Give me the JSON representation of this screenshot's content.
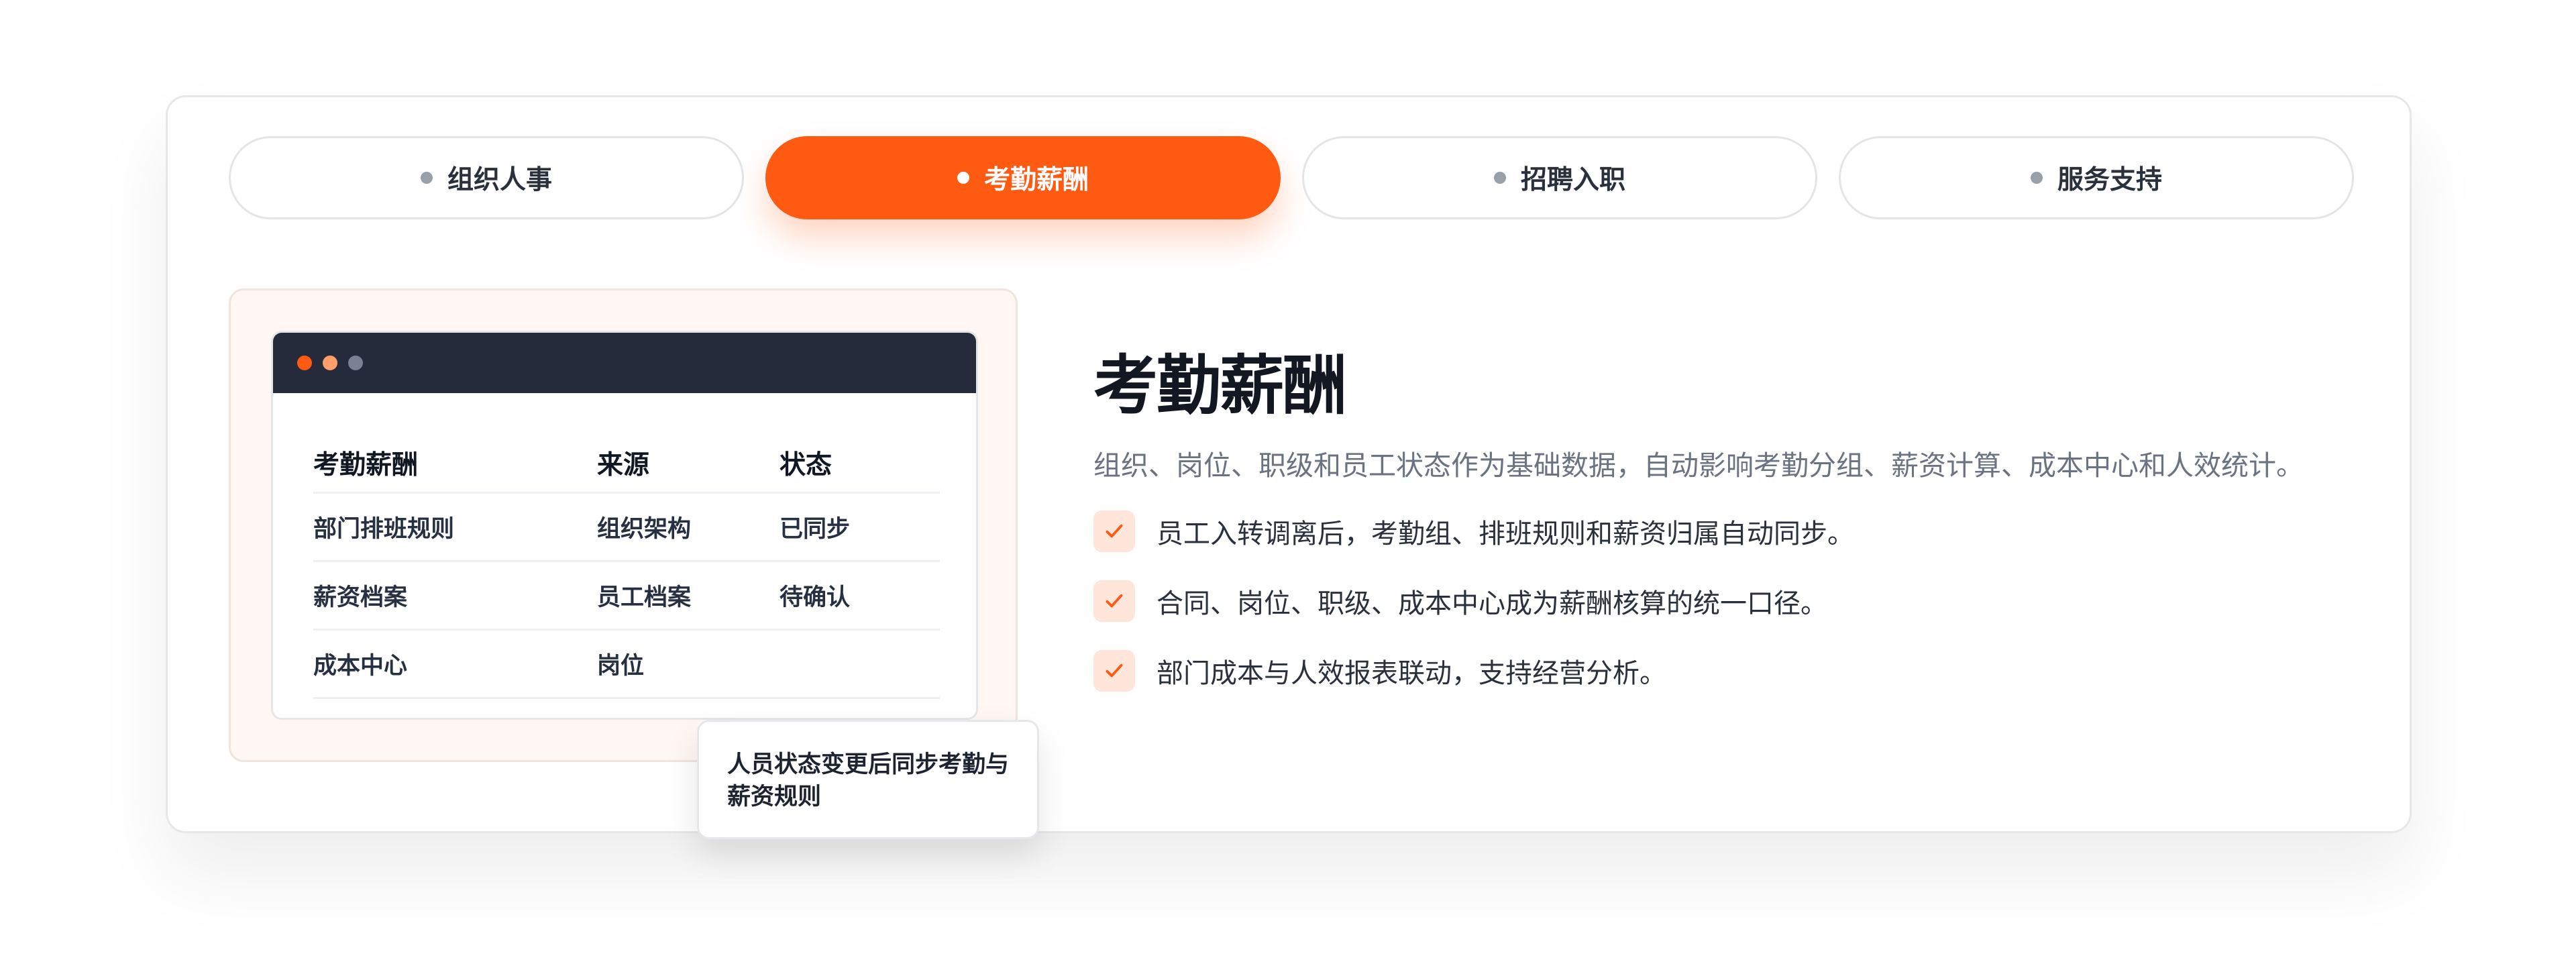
{
  "tabs": [
    {
      "label": "组织人事",
      "active": false
    },
    {
      "label": "考勤薪酬",
      "active": true
    },
    {
      "label": "招聘入职",
      "active": false
    },
    {
      "label": "服务支持",
      "active": false
    }
  ],
  "preview": {
    "table": {
      "headers": [
        "考勤薪酬",
        "来源",
        "状态"
      ],
      "rows": [
        [
          "部门排班规则",
          "组织架构",
          "已同步"
        ],
        [
          "薪资档案",
          "员工档案",
          "待确认"
        ],
        [
          "成本中心",
          "岗位",
          ""
        ]
      ]
    },
    "tooltip": "人员状态变更后同步考勤与薪资规则"
  },
  "content": {
    "title": "考勤薪酬",
    "description": "组织、岗位、职级和员工状态作为基础数据，自动影响考勤分组、薪资计算、成本中心和人效统计。",
    "items": [
      "员工入转调离后，考勤组、排班规则和薪资归属自动同步。",
      "合同、岗位、职级、成本中心成为薪酬核算的统一口径。",
      "部门成本与人效报表联动，支持经营分析。"
    ]
  },
  "colors": {
    "accent": "#ff5a12",
    "dark": "#252b3b",
    "muted": "#6b7282"
  },
  "icons": {
    "check": "checkmark-icon",
    "window_dots": "window-control-dots"
  }
}
